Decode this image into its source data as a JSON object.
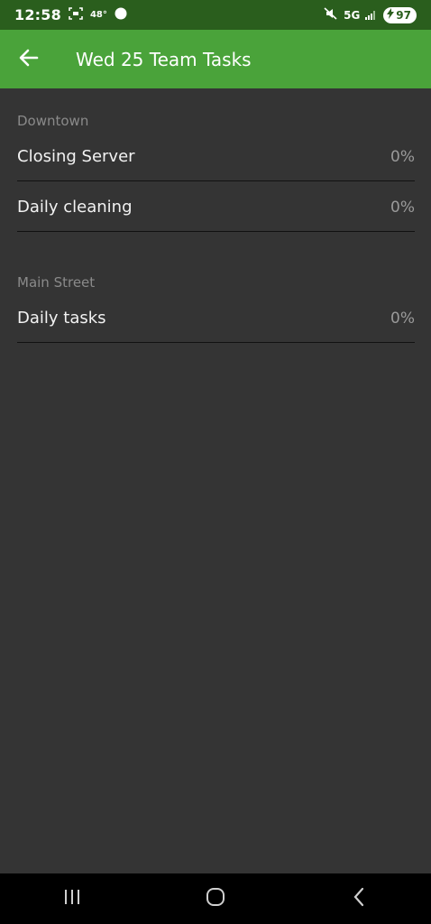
{
  "status_bar": {
    "time": "12:58",
    "temp": "48°",
    "network": "5G",
    "battery": "97"
  },
  "app_bar": {
    "title": "Wed 25 Team Tasks"
  },
  "sections": [
    {
      "header": "Downtown",
      "items": [
        {
          "label": "Closing Server",
          "progress": "0%"
        },
        {
          "label": "Daily cleaning",
          "progress": "0%"
        }
      ]
    },
    {
      "header": "Main Street",
      "items": [
        {
          "label": "Daily tasks",
          "progress": "0%"
        }
      ]
    }
  ],
  "colors": {
    "status_bar_bg": "#2a5e1d",
    "app_bar_bg": "#4aa33a",
    "page_bg": "#343434"
  },
  "icons": [
    "screen-record-icon",
    "notification-icon",
    "mute-icon",
    "signal-icon",
    "battery-charging-icon",
    "back-arrow-icon",
    "recent-apps-icon",
    "home-icon",
    "nav-back-icon"
  ]
}
